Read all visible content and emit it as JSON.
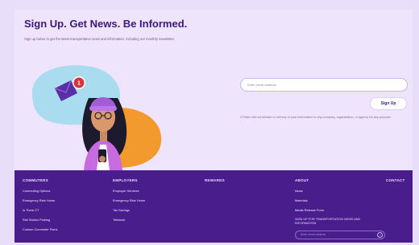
{
  "signup": {
    "title": "Sign Up. Get News. Be Informed.",
    "subtitle": "Sign up below to get the latest transportation news and information, including our monthly newsletter.",
    "email_placeholder": "Enter email address",
    "button_label": "Sign Up",
    "disclaimer": "CTrides will not release or sell any of your information to any company, organization, or agency for any purpose.",
    "notification_count": "1"
  },
  "footer": {
    "columns": [
      {
        "heading": "COMMUTERS",
        "links": [
          "Commuting Options",
          "Emergency Ride Home",
          "Is There CT",
          "Rail Station Parking",
          "Custom Commuter Plans"
        ]
      },
      {
        "heading": "EMPLOYERS",
        "links": [
          "Employer Services",
          "Emergency Ride Home",
          "Tax Savings",
          "Telework"
        ]
      },
      {
        "heading": "REWARDS",
        "links": []
      },
      {
        "heading": "ABOUT",
        "links": [
          "News",
          "Materials",
          "Media Release Form"
        ]
      },
      {
        "heading": "CONTACT",
        "links": []
      }
    ],
    "newsletter_heading": "SIGN UP FOR TRANSPORTATION NEWS AND INFORMATION",
    "newsletter_placeholder": "Enter email address"
  },
  "colors": {
    "page_bg": "#e9defa",
    "footer_bg": "#4a1d8c",
    "title": "#3b1a78",
    "accent_orange": "#f29a2e",
    "accent_blue": "#a9dcef"
  }
}
